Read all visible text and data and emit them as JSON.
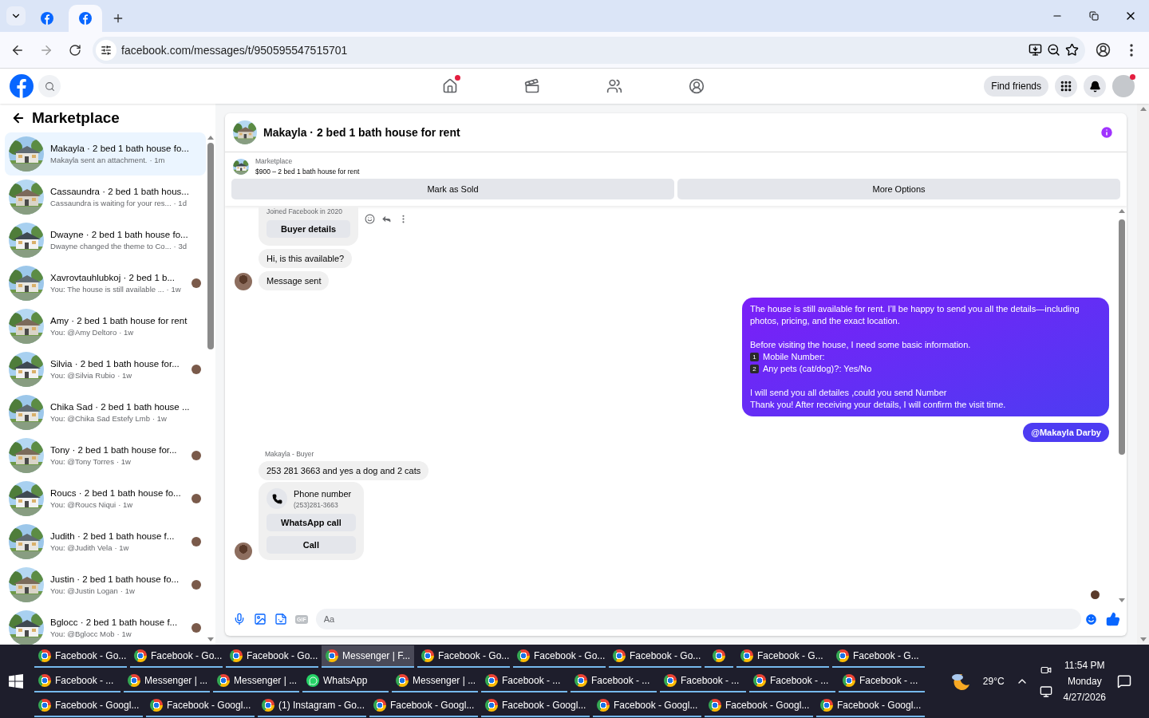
{
  "browser": {
    "tabs": [
      {
        "selected": false
      },
      {
        "selected": true
      }
    ],
    "url": "facebook.com/messages/t/950595547515701"
  },
  "header": {
    "nav": [
      {
        "kind": "home",
        "dot": true
      },
      {
        "kind": "video",
        "dot": false
      },
      {
        "kind": "friends",
        "dot": false
      },
      {
        "kind": "groups",
        "dot": false
      }
    ],
    "find_friends": "Find friends",
    "profile_dot": true
  },
  "sidebar": {
    "title": "Marketplace",
    "conversations": [
      {
        "title": "Makayla · 2 bed 1 bath house fo...",
        "preview": "Makayla sent an attachment.",
        "time": "· 1m",
        "selected": true,
        "read_receipt": false
      },
      {
        "title": "Cassaundra · 2 bed 1 bath hous...",
        "preview": "Cassaundra is waiting for your res...",
        "time": "· 1d",
        "selected": false,
        "read_receipt": false
      },
      {
        "title": "Dwayne · 2 bed 1 bath house fo...",
        "preview": "Dwayne changed the theme to Co...",
        "time": "· 3d",
        "selected": false,
        "read_receipt": false
      },
      {
        "title": "Xavrovtauhlubkoj · 2 bed 1 b...",
        "preview": "You: The house is still available ...",
        "time": "· 1w",
        "selected": false,
        "read_receipt": true
      },
      {
        "title": "Amy · 2 bed 1 bath house for rent",
        "preview": "You: @Amy Deltoro",
        "time": "· 1w",
        "selected": false,
        "read_receipt": false
      },
      {
        "title": "Silvia · 2 bed 1 bath house for...",
        "preview": "You: @Silvia Rubio",
        "time": "· 1w",
        "selected": false,
        "read_receipt": true
      },
      {
        "title": "Chika Sad · 2 bed 1 bath house ...",
        "preview": "You: @Chika Sad Estefy Lmb",
        "time": "· 1w",
        "selected": false,
        "read_receipt": false
      },
      {
        "title": "Tony · 2 bed 1 bath house for...",
        "preview": "You: @Tony Torres",
        "time": "· 1w",
        "selected": false,
        "read_receipt": true
      },
      {
        "title": "Roucs · 2 bed 1 bath house fo...",
        "preview": "You: @Roucs Niqui",
        "time": "· 1w",
        "selected": false,
        "read_receipt": true
      },
      {
        "title": "Judith · 2 bed 1 bath house f...",
        "preview": "You: @Judith Vela",
        "time": "· 1w",
        "selected": false,
        "read_receipt": true
      },
      {
        "title": "Justin · 2 bed 1 bath house fo...",
        "preview": "You: @Justin Logan",
        "time": "· 1w",
        "selected": false,
        "read_receipt": true
      },
      {
        "title": "Bglocc · 2 bed 1 bath house f...",
        "preview": "You: @Bglocc Mob",
        "time": "· 1w",
        "selected": false,
        "read_receipt": true
      }
    ]
  },
  "chat": {
    "title": "Makayla · 2 bed 1 bath house for rent",
    "listing": {
      "source": "Marketplace",
      "price_title": "$900 – 2 bed 1 bath house for rent",
      "actions": [
        "Mark as Sold",
        "More Options"
      ]
    },
    "messages": [
      {
        "kind": "buyer_card",
        "note": "Joined Facebook in 2020",
        "button": "Buyer details"
      },
      {
        "kind": "incoming",
        "text": "Hi, is this available?",
        "avatar": false
      },
      {
        "kind": "incoming",
        "text": "Message sent",
        "avatar": true
      },
      {
        "kind": "outgoing",
        "paragraphs": [
          [
            {
              "text": "The house is still available for rent. I’ll be happy to send you all the details—including photos, pricing, and the exact location."
            }
          ],
          [
            {
              "text": "Before visiting the house, I need some basic information."
            },
            {
              "badge": "1",
              "text": "Mobile Number:"
            },
            {
              "badge": "2",
              "text": "Any pets (cat/dog)?: Yes/No"
            }
          ],
          [
            {
              "text": "I will send you all detailes ,could you send Number"
            },
            {
              "text": "Thank you! After receiving your details, I will confirm the visit time."
            }
          ]
        ]
      },
      {
        "kind": "mention",
        "text": "@Makayla Darby"
      },
      {
        "kind": "label",
        "text": "Makayla - Buyer"
      },
      {
        "kind": "incoming",
        "text": "253 281 3663  and yes a dog and 2 cats",
        "avatar": false
      },
      {
        "kind": "contact_card",
        "title": "Phone number",
        "number": "(253)281-3663",
        "buttons": [
          "WhatsApp call",
          "Call"
        ],
        "avatar": true
      }
    ],
    "seen": true,
    "composer": {
      "gif": "GIF",
      "placeholder": "Aa"
    }
  },
  "taskbar": {
    "rows": [
      {
        "items": [
          {
            "kind": "chrome",
            "label": "Facebook - Go...",
            "selected": false
          },
          {
            "kind": "chrome",
            "label": "Facebook - Go...",
            "selected": false
          },
          {
            "kind": "chrome",
            "label": "Facebook - Go...",
            "selected": false
          },
          {
            "kind": "chrome",
            "label": "Messenger | F...",
            "selected": true
          },
          {
            "kind": "chrome",
            "label": "Facebook - Go...",
            "selected": false
          },
          {
            "kind": "chrome",
            "label": "Facebook - Go...",
            "selected": false
          },
          {
            "kind": "chrome",
            "label": "Facebook - Go...",
            "selected": false
          },
          {
            "kind": "chrome",
            "selected": false
          },
          {
            "kind": "chrome",
            "label": "Facebook - G...",
            "selected": false
          },
          {
            "kind": "chrome",
            "label": "Facebook - G...",
            "selected": false
          }
        ]
      },
      {
        "items": [
          {
            "kind": "chrome",
            "label": "Facebook - ...",
            "selected": false
          },
          {
            "kind": "chrome",
            "label": "Messenger | ...",
            "selected": false
          },
          {
            "kind": "chrome",
            "label": "Messenger | ...",
            "selected": false
          },
          {
            "kind": "whatsapp",
            "label": "WhatsApp",
            "selected": false
          },
          {
            "kind": "chrome",
            "label": "Messenger | ...",
            "selected": false
          },
          {
            "kind": "chrome",
            "label": "Facebook - ...",
            "selected": false
          },
          {
            "kind": "chrome",
            "label": "Facebook - ...",
            "selected": false
          },
          {
            "kind": "chrome",
            "label": "Facebook - ...",
            "selected": false
          },
          {
            "kind": "chrome",
            "label": "Facebook - ...",
            "selected": false
          },
          {
            "kind": "chrome",
            "label": "Facebook - ...",
            "selected": false
          }
        ]
      },
      {
        "items": [
          {
            "kind": "chrome",
            "label": "Facebook - Googl...",
            "selected": false
          },
          {
            "kind": "chrome",
            "label": "Facebook - Googl...",
            "selected": false
          },
          {
            "kind": "chrome",
            "label": "(1) Instagram - Go...",
            "selected": false
          },
          {
            "kind": "chrome",
            "label": "Facebook - Googl...",
            "selected": false
          },
          {
            "kind": "chrome",
            "label": "Facebook - Googl...",
            "selected": false
          },
          {
            "kind": "chrome",
            "label": "Facebook - Googl...",
            "selected": false
          },
          {
            "kind": "chrome",
            "label": "Facebook - Googl...",
            "selected": false
          },
          {
            "kind": "chrome",
            "label": "Facebook - Googl...",
            "selected": false
          }
        ]
      }
    ],
    "weather": "29°C",
    "time": "11:54 PM",
    "day": "Monday",
    "date": "4/27/2026"
  }
}
